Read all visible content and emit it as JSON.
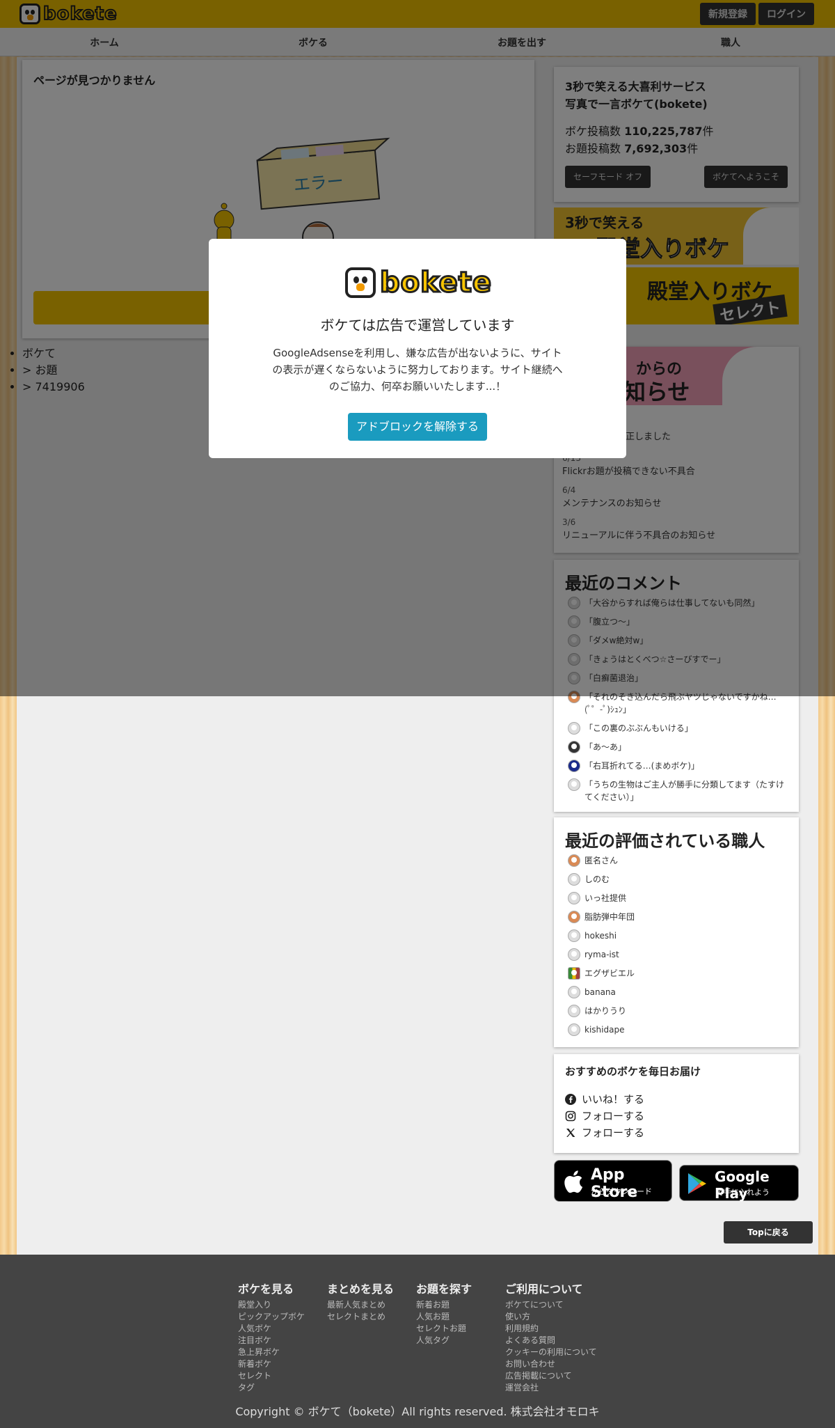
{
  "header": {
    "logo_text": "bokete",
    "signup": "新規登録",
    "login": "ログイン"
  },
  "nav": [
    "ホーム",
    "ボケる",
    "お題を出す",
    "職人"
  ],
  "main": {
    "title": "ページが見つかりません",
    "error_label": "エラー"
  },
  "breadcrumb": [
    "ボケて",
    "> お題",
    "> 7419906"
  ],
  "stats": {
    "title_line1": "3秒で笑える大喜利サービス",
    "title_line2": "写真で一言ボケて(bokete)",
    "boke_label": "ボケ投稿数 ",
    "boke_count": "110,225,787",
    "odai_label": "お題投稿数 ",
    "odai_count": "7,692,303",
    "unit": "件",
    "safe_mode": "セーフモード オフ",
    "welcome": "ボケてへようこそ"
  },
  "banners": {
    "b1_text1": "3秒で笑える",
    "b1_text2": "殿堂入りボケ",
    "b2_text1": "殿堂入りボケ",
    "b2_text2": "セレクト"
  },
  "news": {
    "header1": "からの",
    "header2": "知らせ",
    "items": [
      {
        "date": "",
        "text": "様の不具合を修正しました"
      },
      {
        "date": "6/13",
        "text": "Flickrお題が投稿できない不具合"
      },
      {
        "date": "6/4",
        "text": "メンテナンスのお知らせ"
      },
      {
        "date": "3/6",
        "text": "リニューアルに伴う不具合のお知らせ"
      }
    ]
  },
  "comments": {
    "title": "最近のコメント",
    "items": [
      "「大谷からすれば俺らは仕事してないも同然」",
      "「腹立つ〜」",
      "「ダメw絶対w」",
      "「きょうはとくべつ☆さーびすでー」",
      "「白癬菌退治」",
      "「それのそき込んだら飛ぶヤツじゃないですかね…(ﾟ゜-ﾟ)ｼｭﾝ」",
      "「この裏のぶぶんもいける」",
      "「あ〜あ」",
      "「右耳折れてる…(まめボケ)」",
      "「うちの生物はご主人が勝手に分類してます（たすけてください）」"
    ]
  },
  "shokunin": {
    "title": "最近の評価されている職人",
    "items": [
      "匿名さん",
      "しのむ",
      "いっ社提供",
      "脂肪弾中年団",
      "hokeshi",
      "ryma-ist",
      "エグザビエル",
      "banana",
      "はかりうり",
      "kishidape"
    ]
  },
  "follow": {
    "title": "おすすめのボケを毎日お届け",
    "facebook": "いいね！する",
    "instagram": "フォローする",
    "x": "フォローする"
  },
  "apps": {
    "appstore_big": "App Store",
    "appstore_small": "からダウンロード",
    "gplay_big": "Google Play",
    "gplay_small": "で手に入れよう"
  },
  "top_button": "Topに戻る",
  "footer": {
    "cols": [
      {
        "heading": "ボケを見る",
        "links": [
          "殿堂入り",
          "ピックアップボケ",
          "人気ボケ",
          "注目ボケ",
          "急上昇ボケ",
          "新着ボケ",
          "セレクト",
          "タグ"
        ]
      },
      {
        "heading": "まとめを見る",
        "links": [
          "最新人気まとめ",
          "セレクトまとめ"
        ]
      },
      {
        "heading": "お題を探す",
        "links": [
          "新着お題",
          "人気お題",
          "セレクトお題",
          "人気タグ"
        ]
      },
      {
        "heading": "ご利用について",
        "links": [
          "ボケてについて",
          "使い方",
          "利用規約",
          "よくある質問",
          "クッキーの利用について",
          "お問い合わせ",
          "広告掲載について",
          "運営会社"
        ]
      }
    ],
    "copyright": "Copyright © ボケて（bokete）All rights reserved. 株式会社オモロキ"
  },
  "modal": {
    "logo_text": "bokete",
    "title": "ボケては広告で運営しています",
    "body": "GoogleAdsenseを利用し、嫌な広告が出ないように、サイトの表示が遅くならないように努力しております。サイト継続へのご協力、何卒お願いいたします...！",
    "button": "アドブロックを解除する"
  },
  "colors": {
    "brand_yellow": "#f2c200",
    "modal_button": "#1a9bbf",
    "footer_bg": "#444444"
  }
}
